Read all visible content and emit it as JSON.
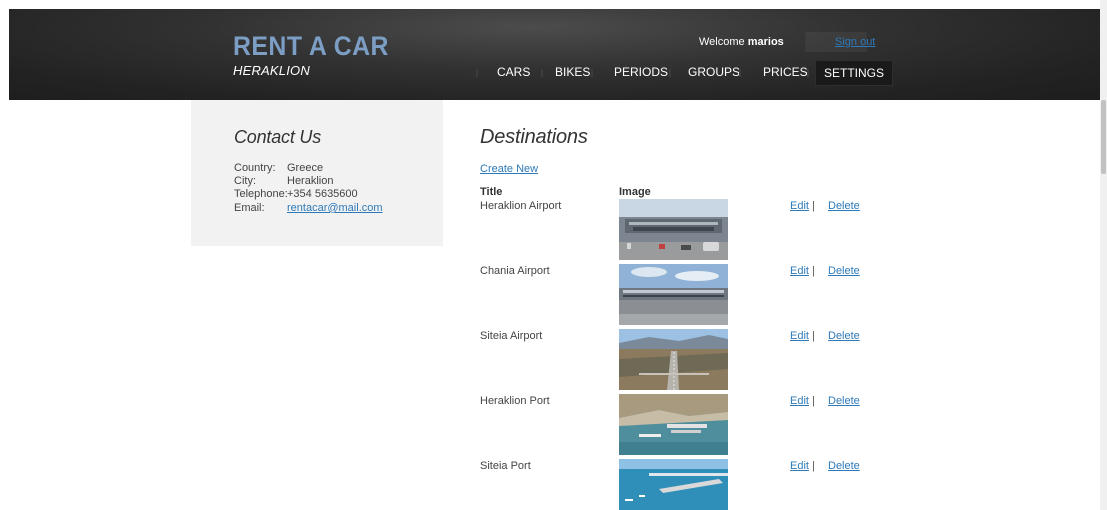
{
  "header": {
    "brand_title": "RENT A CAR",
    "brand_subtitle": "HERAKLION",
    "welcome_text": "Welcome",
    "username": "marios",
    "signout_label": "Sign out",
    "nav": [
      {
        "label": "CARS"
      },
      {
        "label": "BIKES"
      },
      {
        "label": "PERIODS"
      },
      {
        "label": "GROUPS"
      },
      {
        "label": "PRICES"
      },
      {
        "label": "SETTINGS",
        "active": true
      }
    ]
  },
  "sidebar": {
    "title": "Contact Us",
    "contact": [
      {
        "label": "Country:",
        "value": "Greece"
      },
      {
        "label": "City:",
        "value": "Heraklion"
      },
      {
        "label": "Telephone:",
        "value": "+354 5635600"
      },
      {
        "label": "Email:",
        "value": "rentacar@mail.com"
      }
    ]
  },
  "main": {
    "title": "Destinations",
    "create_new_label": "Create New",
    "columns": {
      "title": "Title",
      "image": "Image"
    },
    "edit_label": "Edit",
    "separator": "|",
    "delete_label": "Delete",
    "rows": [
      {
        "title": "Heraklion Airport",
        "image": "airport-terminal-photo"
      },
      {
        "title": "Chania Airport",
        "image": "airport-terminal-photo"
      },
      {
        "title": "Siteia Airport",
        "image": "aerial-runway-photo"
      },
      {
        "title": "Heraklion Port",
        "image": "aerial-port-photo"
      },
      {
        "title": "Siteia Port",
        "image": "harbor-photo"
      }
    ]
  },
  "colors": {
    "header_bg": "#232323",
    "brand_accent": "#7d9ec4",
    "link": "#2e7ab8",
    "sidebar_bg": "#f2f2f2",
    "text": "#333333"
  }
}
